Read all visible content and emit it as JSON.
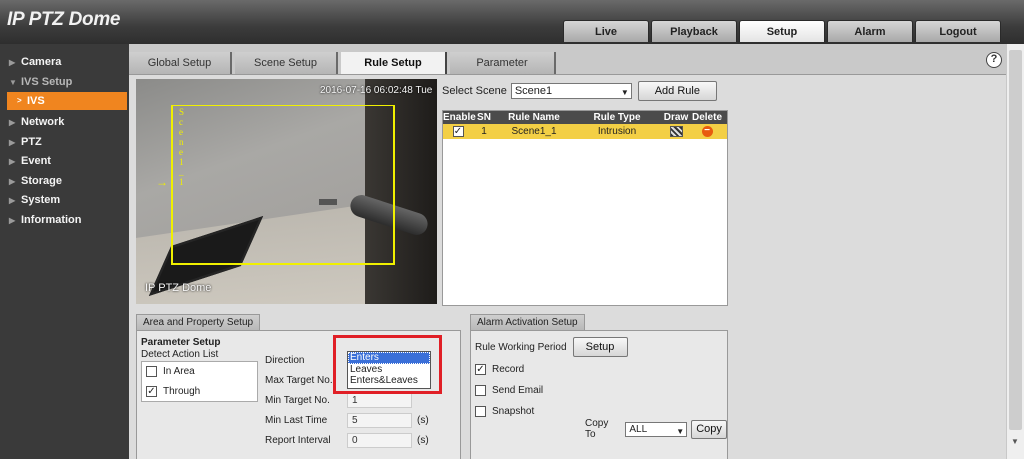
{
  "app": {
    "title": "IP PTZ Dome"
  },
  "topnav": [
    {
      "label": "Live",
      "active": false
    },
    {
      "label": "Playback",
      "active": false
    },
    {
      "label": "Setup",
      "active": true
    },
    {
      "label": "Alarm",
      "active": false
    },
    {
      "label": "Logout",
      "active": false
    }
  ],
  "sidebar": {
    "camera": "Camera",
    "ivs_setup": "IVS Setup",
    "ivs": "IVS",
    "network": "Network",
    "ptz": "PTZ",
    "event": "Event",
    "storage": "Storage",
    "system": "System",
    "information": "Information"
  },
  "subtabs": [
    {
      "label": "Global Setup",
      "active": false
    },
    {
      "label": "Scene Setup",
      "active": false
    },
    {
      "label": "Rule Setup",
      "active": true
    },
    {
      "label": "Parameter",
      "active": false
    }
  ],
  "help": {
    "glyph": "?"
  },
  "video": {
    "osd_time": "2016-07-16 06:02:48 Tue",
    "osd_name": "IP PTZ Dome",
    "rule_label": "Scene1_1",
    "rule_arrow": "→"
  },
  "scene": {
    "label": "Select Scene",
    "value": "Scene1",
    "add_rule_label": "Add Rule"
  },
  "rule_table": {
    "headers": {
      "enable": "Enable",
      "sn": "SN",
      "name": "Rule Name",
      "type": "Rule Type",
      "draw": "Draw",
      "delete": "Delete"
    },
    "rows": [
      {
        "enable": true,
        "sn": "1",
        "name": "Scene1_1",
        "type": "Intrusion"
      }
    ]
  },
  "area": {
    "tab": "Area and Property Setup",
    "param_title": "Parameter Setup",
    "detect_label": "Detect Action List",
    "in_area": "In Area",
    "through": "Through",
    "direction_label": "Direction",
    "direction_options": [
      "Enters",
      "Leaves",
      "Enters&Leaves"
    ],
    "direction_selected": "Enters",
    "max_target_label": "Max Target No.",
    "min_target_label": "Min Target No.",
    "min_target_value": "1",
    "min_last_label": "Min Last Time",
    "min_last_value": "5",
    "report_label": "Report Interval",
    "report_value": "0",
    "unit_s": "(s)"
  },
  "alarm": {
    "tab": "Alarm Activation Setup",
    "working_label": "Rule Working Period",
    "setup_label": "Setup",
    "record": "Record",
    "record_checked": true,
    "send_email": "Send Email",
    "snapshot": "Snapshot",
    "copy_to_label": "Copy To",
    "copy_to_value": "ALL",
    "copy_label": "Copy"
  },
  "colors": {
    "accent": "#f0851f",
    "selected_row": "#f3cf45",
    "highlight": "#e01f26",
    "rule_line": "#f0f000"
  }
}
